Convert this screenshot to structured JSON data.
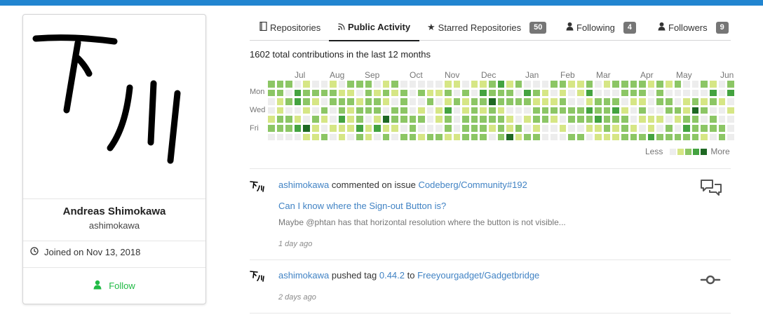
{
  "colors": {
    "topbar": "#2185d0",
    "link": "#4183c4",
    "follow": "#21ba45",
    "heat": [
      "#ededed",
      "#d6e685",
      "#8cc665",
      "#44a340",
      "#1e6823"
    ]
  },
  "profile": {
    "full_name": "Andreas Shimokawa",
    "username": "ashimokawa",
    "joined": "Joined on Nov 13, 2018",
    "follow_label": "Follow",
    "avatar_text": "下川"
  },
  "tabs": [
    {
      "label": "Repositories",
      "icon": "repo-icon"
    },
    {
      "label": "Public Activity",
      "icon": "rss-icon",
      "active": true
    },
    {
      "label": "Starred Repositories",
      "icon": "star-icon",
      "count": "50"
    },
    {
      "label": "Following",
      "icon": "person-icon",
      "count": "4"
    },
    {
      "label": "Followers",
      "icon": "person-icon",
      "count": "9"
    }
  ],
  "contributions": {
    "summary": "1602 total contributions in the last 12 months",
    "months": [
      "Jul",
      "Aug",
      "Sep",
      "Oct",
      "Nov",
      "Dec",
      "Jan",
      "Feb",
      "Mar",
      "Apr",
      "May",
      "Jun"
    ],
    "days": [
      "Mon",
      "Wed",
      "Fri"
    ],
    "legend_less": "Less",
    "legend_more": "More"
  },
  "feed": [
    {
      "user": "ashimokawa",
      "action": "commented on issue",
      "target": "Codeberg/Community#192",
      "title": "Can I know where the Sign-out Button is?",
      "desc": "Maybe @phtan has that horizontal resolution where the button is not visible...",
      "time": "1 day ago",
      "icon": "comment-discussion-icon"
    },
    {
      "user": "ashimokawa",
      "action": "pushed tag",
      "tag": "0.44.2",
      "connector": "to",
      "target": "Freeyourgadget/Gadgetbridge",
      "time": "2 days ago",
      "icon": "git-commit-icon"
    }
  ]
}
